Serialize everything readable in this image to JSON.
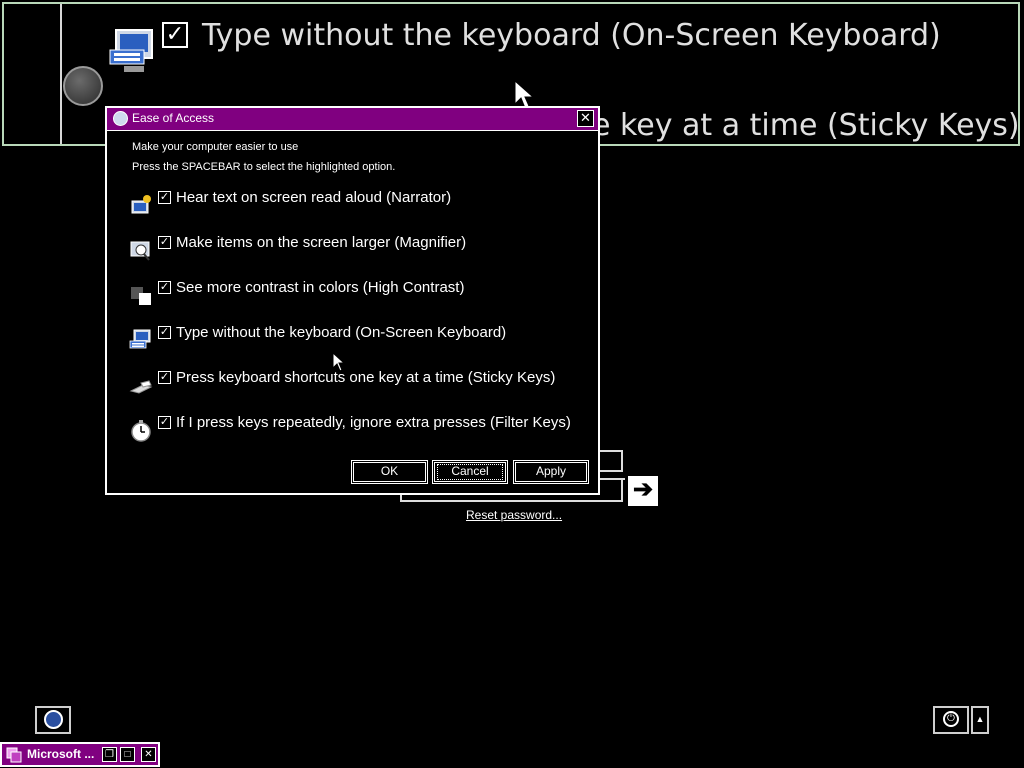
{
  "magnifier": {
    "line1": "Type without the keyboard (On-Screen Keyboard)",
    "line2": "e key at a time (Sticky Keys)",
    "check": "✓"
  },
  "dialog": {
    "title": "Ease of Access",
    "close": "✕",
    "intro1": "Make your computer easier to use",
    "intro2": "Press the SPACEBAR to select the highlighted option.",
    "options": [
      {
        "label": "Hear text on screen read aloud (Narrator)",
        "icon": "narrator-icon",
        "checked": true
      },
      {
        "label": "Make items on the screen larger (Magnifier)",
        "icon": "magnifier-icon",
        "checked": true
      },
      {
        "label": "See more contrast in colors (High Contrast)",
        "icon": "high-contrast-icon",
        "checked": true
      },
      {
        "label": "Type without the keyboard (On-Screen Keyboard)",
        "icon": "on-screen-keyboard-icon",
        "checked": true
      },
      {
        "label": "Press keyboard shortcuts one key at a time (Sticky Keys)",
        "icon": "sticky-keys-icon",
        "checked": true
      },
      {
        "label": "If I press keys repeatedly, ignore extra presses (Filter Keys)",
        "icon": "filter-keys-icon",
        "checked": true
      }
    ],
    "check_mark": "✓",
    "buttons": {
      "ok": "OK",
      "cancel": "Cancel",
      "apply": "Apply"
    }
  },
  "login": {
    "go": "➔",
    "reset_link": "Reset password..."
  },
  "bottom": {
    "power_glyph": "⏻",
    "power_options_glyph": "▲"
  },
  "taskbar": {
    "label": "Microsoft ...",
    "restore": "❐",
    "maximize": "□",
    "close": "✕"
  },
  "colors": {
    "title_bar": "#800080",
    "background": "#000000",
    "foreground": "#ffffff"
  }
}
